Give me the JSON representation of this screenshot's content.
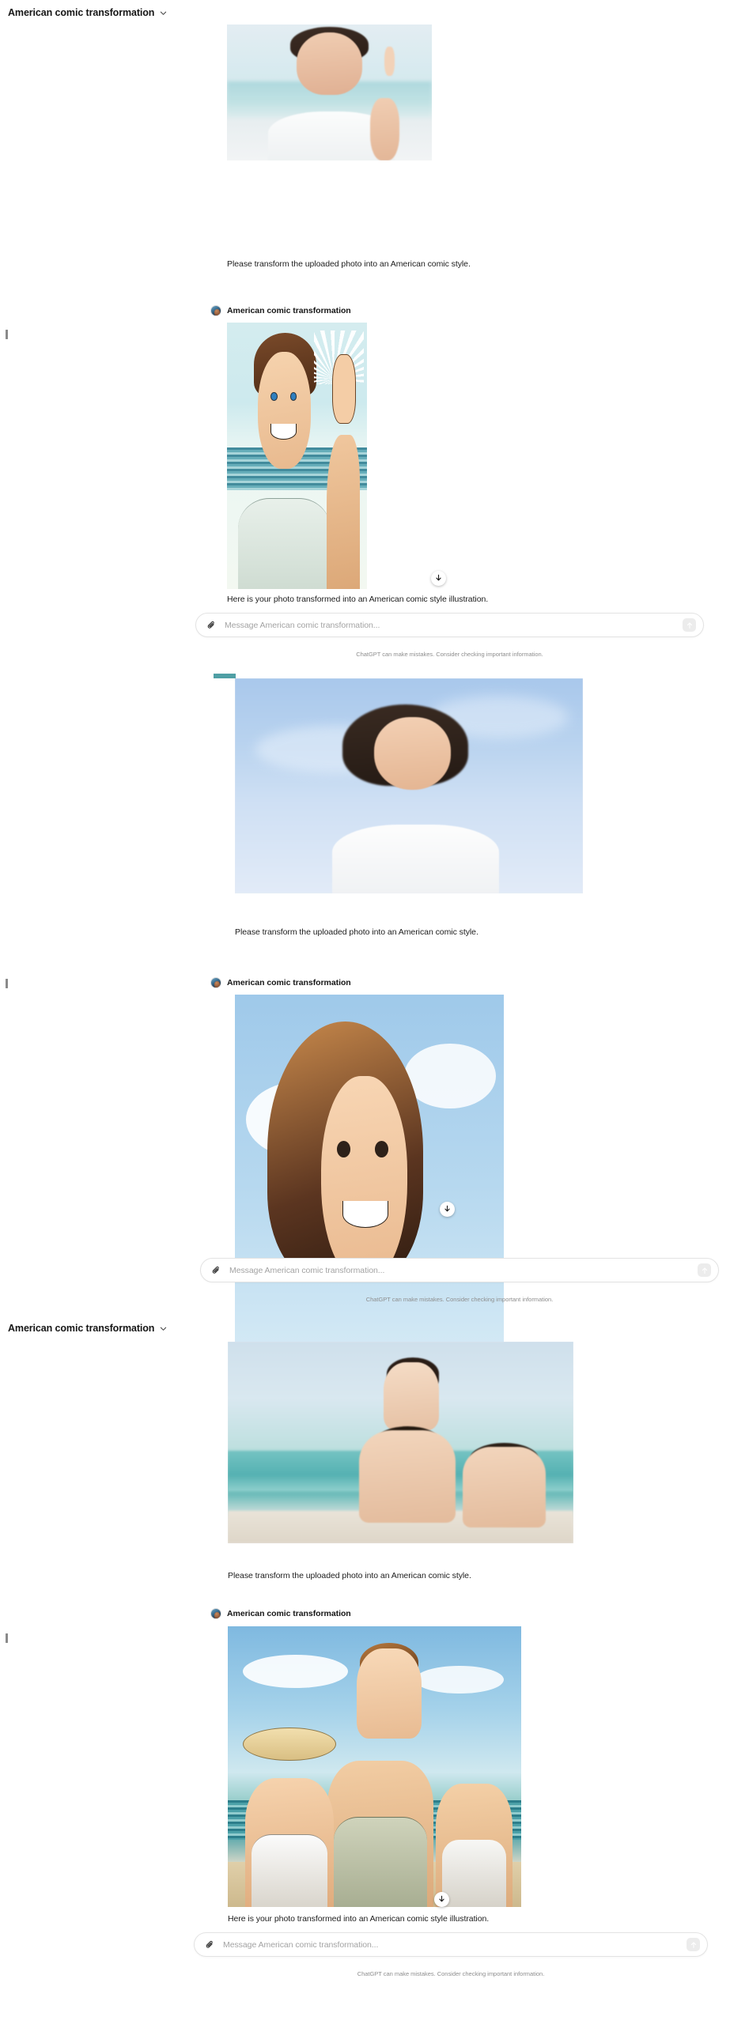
{
  "app": {
    "disclaimer": "ChatGPT can make mistakes. Consider checking important information.",
    "composer_placeholder": "Message American comic transformation...",
    "conversation_title": "American comic transformation",
    "assistant_name": "American comic transformation",
    "user_prompt": "Please transform the uploaded photo into an American comic style.",
    "assistant_reply": "Here is your photo transformed into an American comic style illustration."
  },
  "icons": {
    "chevron_down": "chevron-down-icon",
    "paperclip": "paperclip-icon",
    "send_arrow": "send-arrow-icon",
    "download": "download-icon"
  },
  "colors": {
    "page_background": "#ffffff",
    "text_primary": "#1c1c1c",
    "text_muted": "#8e8e8e",
    "border": "#e3e3e3",
    "send_button_background": "#ececec",
    "caret_mark": "#8a8a8a"
  },
  "sections": [
    {
      "id": "section-1",
      "title": "American comic transformation",
      "user_prompt": "Please transform the uploaded photo into an American comic style.",
      "assistant_name": "American comic transformation",
      "assistant_reply": "Here is your photo transformed into an American comic style illustration.",
      "uploaded_image_alt": "Smiling young man at the beach pointing upward",
      "result_image_alt": "American comic style illustration of a smiling man pointing upward at the beach",
      "composer_placeholder": "Message American comic transformation...",
      "disclaimer": "ChatGPT can make mistakes. Consider checking important information."
    },
    {
      "id": "section-2",
      "title": "American comic transformation",
      "user_prompt": "Please transform the uploaded photo into an American comic style.",
      "assistant_name": "American comic transformation",
      "assistant_reply": "",
      "uploaded_image_alt": "Woman with short hair smiling against a blue sky",
      "result_image_alt": "American comic style illustration of a smiling woman against a blue sky",
      "composer_placeholder": "Message American comic transformation...",
      "disclaimer": "ChatGPT can make mistakes. Consider checking important information."
    },
    {
      "id": "section-3",
      "title": "American comic transformation",
      "user_prompt": "Please transform the uploaded photo into an American comic style.",
      "assistant_name": "American comic transformation",
      "assistant_reply": "Here is your photo transformed into an American comic style illustration.",
      "uploaded_image_alt": "Family of three at the beach with a child on a man's shoulders",
      "result_image_alt": "American comic style illustration of a family of three at the beach",
      "composer_placeholder": "Message American comic transformation...",
      "disclaimer": "ChatGPT can make mistakes. Consider checking important information."
    }
  ]
}
